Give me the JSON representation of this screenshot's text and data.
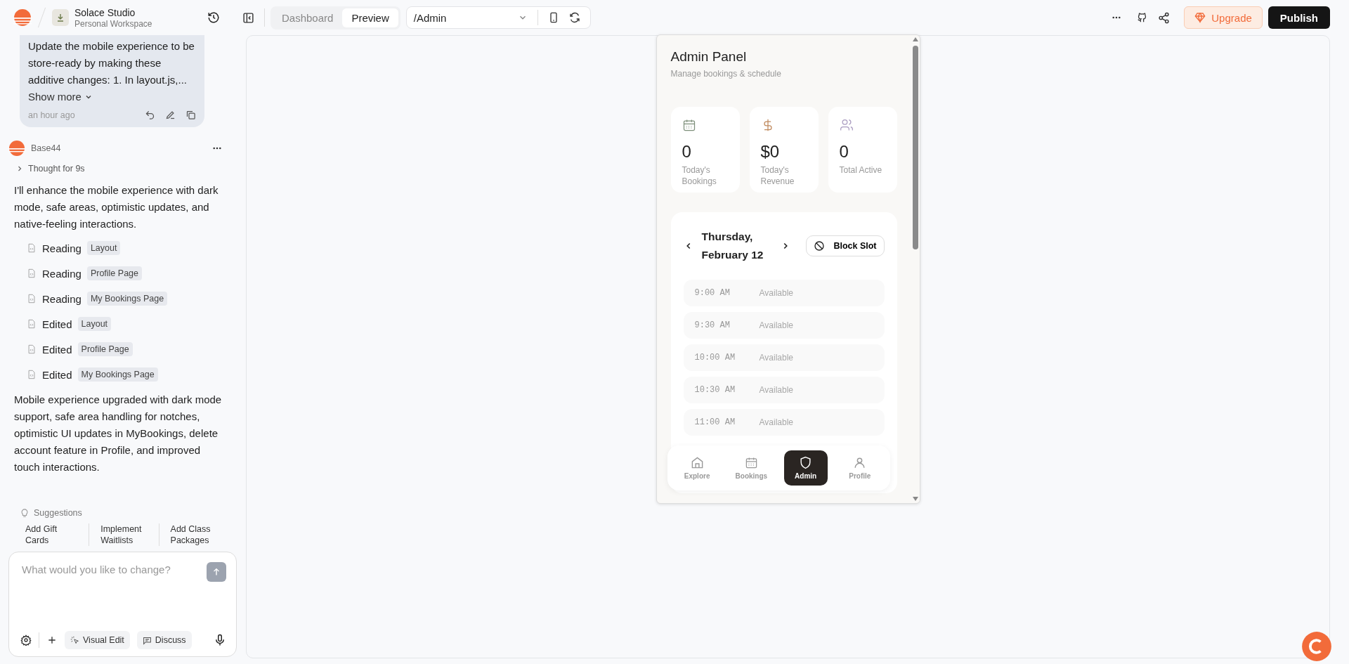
{
  "header": {
    "project": "Solace Studio",
    "workspace": "Personal Workspace"
  },
  "chat": {
    "user_message": {
      "text": "Update the mobile experience to be store-ready by making these additive changes: 1. In layout.js,...",
      "show_more": "Show more",
      "time": "an hour ago"
    },
    "assistant": {
      "name": "Base44",
      "thought": "Thought for 9s",
      "intro": "I'll enhance the mobile experience with dark mode, safe areas, optimistic updates, and native-feeling interactions.",
      "actions": [
        {
          "verb": "Reading",
          "file": "Layout"
        },
        {
          "verb": "Reading",
          "file": "Profile Page"
        },
        {
          "verb": "Reading",
          "file": "My Bookings Page"
        },
        {
          "verb": "Edited",
          "file": "Layout"
        },
        {
          "verb": "Edited",
          "file": "Profile Page"
        },
        {
          "verb": "Edited",
          "file": "My Bookings Page"
        }
      ],
      "summary": "Mobile experience upgraded with dark mode support, safe area handling for notches, optimistic UI updates in MyBookings, delete account feature in Profile, and improved touch interactions."
    }
  },
  "suggestions": {
    "label": "Suggestions",
    "items": [
      "Add Gift Cards",
      "Implement Waitlists",
      "Add Class Packages"
    ]
  },
  "composer": {
    "placeholder": "What would you like to change?",
    "tools": [
      "Visual Edit",
      "Discuss"
    ]
  },
  "toolbar": {
    "tabs": [
      {
        "label": "Dashboard",
        "selected": false
      },
      {
        "label": "Preview",
        "selected": true
      }
    ],
    "route": "/Admin",
    "upgrade": "Upgrade",
    "publish": "Publish"
  },
  "app": {
    "title": "Admin Panel",
    "subtitle": "Manage bookings & schedule",
    "stats": [
      {
        "kind": "calendar",
        "value": "0",
        "label": "Today's Bookings"
      },
      {
        "kind": "dollar",
        "value": "$0",
        "label": "Today's Revenue"
      },
      {
        "kind": "users",
        "value": "0",
        "label": "Total Active"
      }
    ],
    "date": "Thursday, February 12",
    "block_slot": "Block Slot",
    "slots": [
      {
        "time": "9:00 AM",
        "status": "Available"
      },
      {
        "time": "9:30 AM",
        "status": "Available"
      },
      {
        "time": "10:00 AM",
        "status": "Available"
      },
      {
        "time": "10:30 AM",
        "status": "Available"
      },
      {
        "time": "11:00 AM",
        "status": "Available"
      }
    ],
    "nav": [
      {
        "kind": "home",
        "label": "Explore",
        "selected": false
      },
      {
        "kind": "calendar",
        "label": "Bookings",
        "selected": false
      },
      {
        "kind": "shield",
        "label": "Admin",
        "selected": true
      },
      {
        "kind": "user",
        "label": "Profile",
        "selected": false
      }
    ]
  }
}
